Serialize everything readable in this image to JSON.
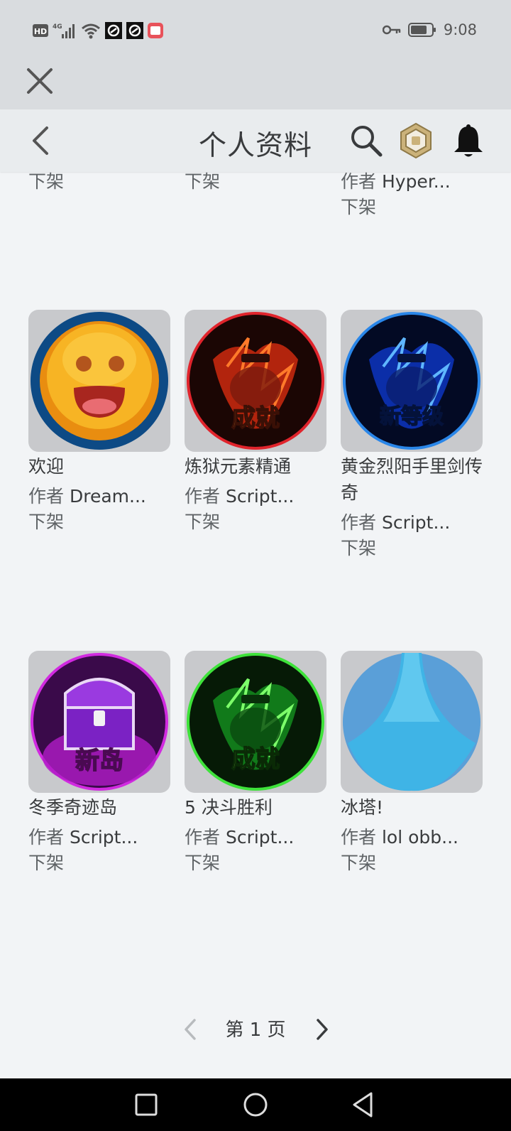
{
  "status_bar": {
    "hd": "HD",
    "network": "4G",
    "time": "9:08"
  },
  "header": {
    "title": "个人资料"
  },
  "partial_row": [
    {
      "status": "下架"
    },
    {
      "status": "下架"
    },
    {
      "creator_prefix": "作者",
      "creator": "Hyper...",
      "status": "下架"
    }
  ],
  "items": [
    {
      "name": "欢迎",
      "creator_prefix": "作者",
      "creator": "Dream...",
      "status": "下架",
      "overlay": ""
    },
    {
      "name": "炼狱元素精通",
      "creator_prefix": "作者",
      "creator": "Script...",
      "status": "下架",
      "overlay": "成就"
    },
    {
      "name": "黄金烈阳手里剑传奇",
      "creator_prefix": "作者",
      "creator": "Script...",
      "status": "下架",
      "overlay": "新等级"
    },
    {
      "name": "冬季奇迹岛",
      "creator_prefix": "作者",
      "creator": "Script...",
      "status": "下架",
      "overlay": "新岛"
    },
    {
      "name": "5 决斗胜利",
      "creator_prefix": "作者",
      "creator": "Script...",
      "status": "下架",
      "overlay": "成就"
    },
    {
      "name": "冰塔!",
      "creator_prefix": "作者",
      "creator": "lol obb...",
      "status": "下架",
      "overlay": ""
    }
  ],
  "pager": {
    "label": "第 1 页"
  },
  "colors": {
    "background": "#f2f4f6",
    "header": "#e9ecee",
    "status_bar": "#d9dcdf",
    "text": "#393b3d",
    "muted": "#5f6366",
    "thumb_bg": "#c8c9cc"
  },
  "icons": [
    "close-icon",
    "back-icon",
    "search-icon",
    "robux-icon",
    "bell-icon",
    "chevron-left-icon",
    "chevron-right-icon",
    "nav-recents-icon",
    "nav-home-icon",
    "nav-back-icon"
  ]
}
